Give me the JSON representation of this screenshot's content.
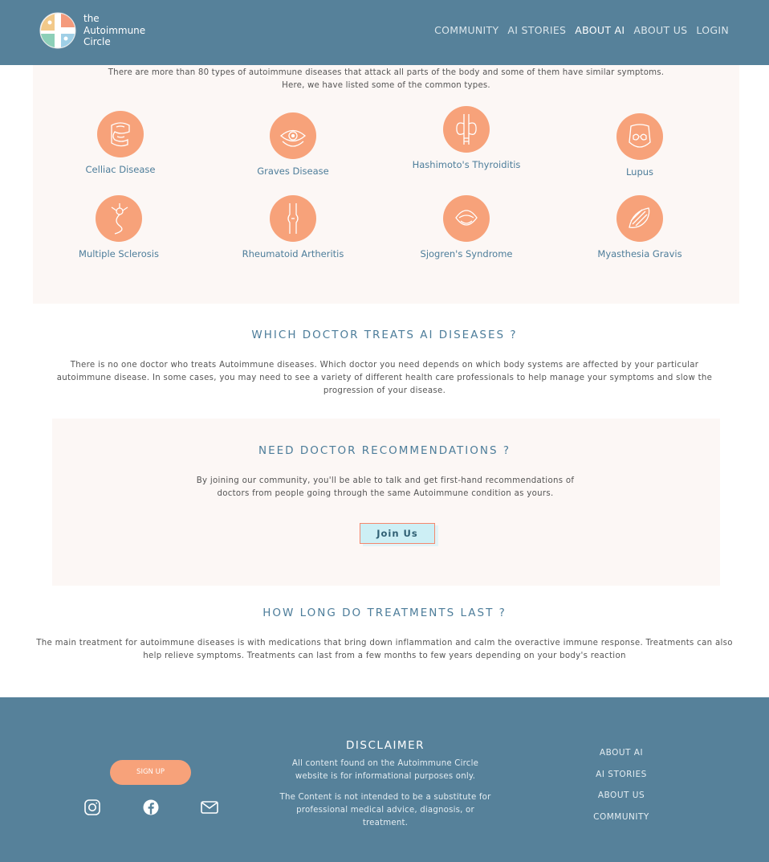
{
  "header": {
    "logo_text": [
      "the",
      "Autoimmune",
      "Circle"
    ],
    "nav": [
      "COMMUNITY",
      "AI STORIES",
      "ABOUT AI",
      "ABOUT US",
      "LOGIN"
    ],
    "active": "ABOUT AI"
  },
  "types": {
    "intro": [
      "There are more than 80 types of autoimmune diseases that attack all parts of the body and some of them have similar symptoms.",
      "Here, we have listed some of the common types."
    ],
    "diseases": [
      {
        "name": "Celliac Disease",
        "icon": "intestine-icon"
      },
      {
        "name": "Graves Disease",
        "icon": "eye-icon"
      },
      {
        "name": "Hashimoto's Thyroiditis",
        "icon": "thyroid-icon"
      },
      {
        "name": "Lupus",
        "icon": "face-rash-icon"
      },
      {
        "name": "Multiple Sclerosis",
        "icon": "neuron-icon"
      },
      {
        "name": "Rheumatoid Artheritis",
        "icon": "joint-icon"
      },
      {
        "name": "Sjogren's Syndrome",
        "icon": "mouth-icon"
      },
      {
        "name": "Myasthesia Gravis",
        "icon": "muscle-icon"
      }
    ]
  },
  "doctor": {
    "title": "WHICH DOCTOR TREATS AI DISEASES ?",
    "text": [
      "There is no one doctor who treats Autoimmune diseases. Which doctor you need depends on which body systems are affected by your particular",
      "autoimmune disease. In some cases, you may need to see a variety of different health care professionals to help manage your symptoms and slow the",
      "progression of your disease."
    ]
  },
  "recommend": {
    "title": "NEED DOCTOR RECOMMENDATIONS ?",
    "text": [
      "By joining our community, you'll be able to talk and get first-hand recommendations of",
      "doctors from people going through the same Autoimmune condition as yours."
    ],
    "button": "Join Us"
  },
  "treatment": {
    "title": "HOW LONG DO TREATMENTS LAST ?",
    "text": [
      "The main treatment for autoimmune diseases is with medications that bring down inflammation and calm the overactive immune response. Treatments can also",
      "help relieve symptoms. Treatments can last from a few months to few years depending on your body's reaction"
    ]
  },
  "footer": {
    "signup": "SIGN UP",
    "disclaimer_title": "DISCLAIMER",
    "disclaimer_1": [
      "All content found on the Autoimmune Circle",
      "website is for informational purposes only."
    ],
    "disclaimer_2": [
      "The Content is not intended to be a substitute for",
      "professional medical advice, diagnosis, or",
      "treatment."
    ],
    "links": [
      "ABOUT AI",
      "AI STORIES",
      "ABOUT US",
      "COMMUNITY"
    ]
  },
  "colors": {
    "header": "#56819a",
    "accent": "#f7a27a",
    "title": "#4d7d9a",
    "panel": "#fcf7f5"
  }
}
